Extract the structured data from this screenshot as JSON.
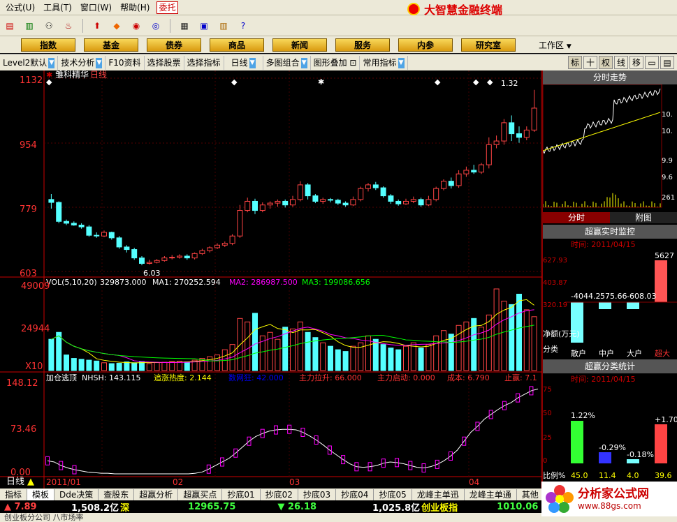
{
  "menus": [
    "公式(U)",
    "工具(T)",
    "窗口(W)",
    "帮助(H)"
  ],
  "trust": "委托",
  "brand": "大智慧金融终端",
  "categories": [
    "指数",
    "基金",
    "债券",
    "商品",
    "新闻",
    "服务",
    "内参",
    "研究室"
  ],
  "workspace": "工作区",
  "controls": [
    "Level2默认",
    "技术分析",
    "F10资料",
    "选择股票",
    "选择指标",
    "日线",
    "多图组合",
    "图形叠加",
    "常用指标"
  ],
  "right_buttons": [
    "标",
    "十",
    "权",
    "线",
    "移"
  ],
  "chart": {
    "title": "雏科精华",
    "period": "日线",
    "price_ticks": [
      "1132",
      "954",
      "779",
      "603"
    ],
    "high_label": "1132",
    "high_note": "1.32",
    "low_label": "6.03",
    "vol_ticks": [
      "49009",
      "24944",
      "X10"
    ],
    "vol_line": {
      "name": "VOL(5,10,20)",
      "value": "329873.000",
      "ma1": "MA1: 270252.594",
      "ma2": "MA2: 286987.500",
      "ma3": "MA3: 199086.656"
    },
    "ind_ticks": [
      "148.12",
      "73.46",
      "0.00"
    ],
    "ind_line": {
      "name": "加仓逃顶",
      "a": "NHSH: 143.115",
      "b": "追涨热度: 2.144",
      "c": "数网狂: 42.000",
      "d": "主力拉升: 66.000",
      "e": "主力启动: 0.000",
      "f": "成本: 6.790",
      "g": "止赢: 7.1"
    },
    "dates": [
      "2011/01",
      "02",
      "03",
      "04"
    ],
    "period_label": "日线"
  },
  "chart_data": [
    {
      "type": "candlestick",
      "title": "雏科精华 日线",
      "ylim": [
        603,
        1132
      ],
      "candles": [
        [
          800,
          792,
          815,
          775
        ],
        [
          792,
          740,
          795,
          735
        ],
        [
          740,
          735,
          745,
          730
        ],
        [
          735,
          730,
          740,
          728
        ],
        [
          730,
          725,
          735,
          720
        ],
        [
          725,
          702,
          730,
          698
        ],
        [
          702,
          700,
          710,
          695
        ],
        [
          700,
          710,
          715,
          697
        ],
        [
          710,
          695,
          712,
          690
        ],
        [
          695,
          670,
          700,
          665
        ],
        [
          670,
          663,
          675,
          655
        ],
        [
          663,
          640,
          668,
          635
        ],
        [
          640,
          625,
          645,
          620
        ],
        [
          625,
          628,
          635,
          622
        ],
        [
          628,
          633,
          637,
          625
        ],
        [
          633,
          640,
          645,
          630
        ],
        [
          640,
          642,
          648,
          636
        ],
        [
          642,
          645,
          650,
          638
        ],
        [
          645,
          640,
          650,
          635
        ],
        [
          640,
          652,
          655,
          636
        ],
        [
          652,
          660,
          665,
          648
        ],
        [
          660,
          668,
          672,
          655
        ],
        [
          668,
          675,
          680,
          664
        ],
        [
          675,
          680,
          685,
          670
        ],
        [
          680,
          700,
          705,
          675
        ],
        [
          700,
          770,
          785,
          695
        ],
        [
          770,
          795,
          805,
          765
        ],
        [
          795,
          770,
          802,
          760
        ],
        [
          770,
          785,
          792,
          765
        ],
        [
          785,
          790,
          795,
          775
        ],
        [
          790,
          795,
          800,
          780
        ],
        [
          795,
          785,
          800,
          778
        ],
        [
          785,
          800,
          810,
          780
        ],
        [
          800,
          840,
          850,
          795
        ],
        [
          840,
          810,
          845,
          800
        ],
        [
          810,
          795,
          815,
          790
        ],
        [
          795,
          800,
          805,
          788
        ],
        [
          800,
          798,
          804,
          792
        ],
        [
          798,
          790,
          802,
          785
        ],
        [
          790,
          785,
          795,
          780
        ],
        [
          785,
          800,
          808,
          782
        ],
        [
          800,
          830,
          835,
          795
        ],
        [
          830,
          840,
          845,
          822
        ],
        [
          840,
          832,
          848,
          826
        ],
        [
          832,
          810,
          836,
          805
        ],
        [
          810,
          795,
          815,
          788
        ],
        [
          795,
          788,
          800,
          783
        ],
        [
          788,
          795,
          802,
          785
        ],
        [
          795,
          800,
          808,
          790
        ],
        [
          800,
          785,
          805,
          780
        ],
        [
          785,
          800,
          810,
          782
        ],
        [
          800,
          830,
          835,
          795
        ],
        [
          830,
          850,
          855,
          825
        ],
        [
          850,
          838,
          860,
          830
        ],
        [
          838,
          870,
          880,
          832
        ],
        [
          870,
          880,
          890,
          862
        ],
        [
          880,
          875,
          895,
          870
        ],
        [
          875,
          895,
          900,
          870
        ],
        [
          895,
          950,
          970,
          885
        ],
        [
          950,
          960,
          975,
          940
        ],
        [
          960,
          1010,
          1020,
          950
        ],
        [
          1010,
          980,
          1030,
          960
        ],
        [
          980,
          970,
          1000,
          955
        ],
        [
          970,
          990,
          1000,
          962
        ],
        [
          990,
          1050,
          1100,
          985
        ]
      ]
    },
    {
      "type": "bar",
      "title": "VOL(5,10,20)",
      "ylim": [
        0,
        49009
      ],
      "series": [
        {
          "name": "VOL",
          "values": [
            18000,
            22000,
            9000,
            7000,
            6500,
            6000,
            5500,
            4500,
            4000,
            4200,
            5000,
            4500,
            5200,
            4000,
            4600,
            4800,
            5200,
            5400,
            5000,
            6000,
            7000,
            8000,
            9000,
            12000,
            15000,
            30000,
            28000,
            33000,
            20000,
            22000,
            18000,
            25000,
            24000,
            28000,
            22000,
            19000,
            16000,
            14000,
            12000,
            11000,
            14000,
            16000,
            20000,
            18000,
            15000,
            13000,
            12000,
            14000,
            16000,
            13000,
            15000,
            20000,
            23000,
            21000,
            26000,
            28000,
            30000,
            25000,
            32000,
            47000,
            40000,
            38000,
            44000,
            35000,
            31000
          ]
        }
      ]
    },
    {
      "type": "line",
      "title": "加仓逃顶",
      "ylim": [
        0,
        148.12
      ],
      "series": [
        {
          "name": "NHSH",
          "values": [
            22,
            20,
            14,
            10,
            7,
            5,
            3,
            2,
            1,
            1,
            0,
            0,
            0,
            0,
            0,
            0,
            0,
            0,
            0,
            0,
            0,
            0,
            1,
            3,
            8,
            14,
            20,
            26,
            35,
            45,
            55,
            63,
            68,
            72,
            74,
            75,
            75,
            74,
            70,
            64,
            57,
            49,
            40,
            32,
            24,
            17,
            12,
            11,
            12,
            14,
            18,
            20,
            19,
            17,
            14,
            11,
            10,
            12,
            16,
            22,
            30,
            40,
            55,
            70,
            80,
            92,
            100,
            108,
            115,
            120,
            128,
            134,
            140,
            143
          ]
        }
      ]
    }
  ],
  "right_panel": {
    "title1": "分时走势",
    "tabs": [
      "分时",
      "附图"
    ],
    "ticks1": [
      "10.",
      "10.",
      "9.9",
      "9.6",
      "261"
    ],
    "title2": "超赢实时监控",
    "time2": "时间: 2011/04/15",
    "vals2": [
      "5627",
      "627.93",
      "403.87",
      "320.19"
    ],
    "bars2": [
      "-4044.2",
      "575.66",
      "-608.03"
    ],
    "label2": "净额(万元)",
    "group": "分类",
    "groups": [
      "散户",
      "中户",
      "大户",
      "超大"
    ],
    "title3": "超赢分类统计",
    "time3": "时间: 2011/04/15",
    "ticks3": [
      "75",
      "50",
      "25",
      "0"
    ],
    "bars3": [
      "1.22%",
      "-0.29%",
      "-0.18%",
      "+1.70"
    ],
    "ratio_label": "比例%",
    "ratio_vals": [
      "45.0",
      "11.4",
      "4.0",
      "39.6"
    ]
  },
  "bottom_tabs": [
    "指标",
    "模板",
    "Dde决策",
    "查股东",
    "超赢分析",
    "超赢买点",
    "抄底01",
    "抄底02",
    "抄底03",
    "抄底04",
    "抄底05",
    "龙峰主单迅",
    "龙峰主单通",
    "其他"
  ],
  "ticker": [
    {
      "label": "▲ 7.89",
      "color": "#ff4040"
    },
    {
      "label": "1,508.2亿",
      "color": "#ffffff"
    },
    {
      "label": "深",
      "color": "#ffff00"
    },
    {
      "label": "12965.75",
      "color": "#40ff40"
    },
    {
      "label": "▼ 26.18",
      "color": "#40ff40"
    },
    {
      "label": "1,025.8亿",
      "color": "#ffffff"
    },
    {
      "label": "创业板指",
      "color": "#ffff00"
    },
    {
      "label": "1010.06",
      "color": "#40ff40"
    }
  ],
  "status": "创业板分公司 八市场率",
  "watermark": {
    "title": "分析家公式网",
    "url": "www.88gs.com"
  }
}
